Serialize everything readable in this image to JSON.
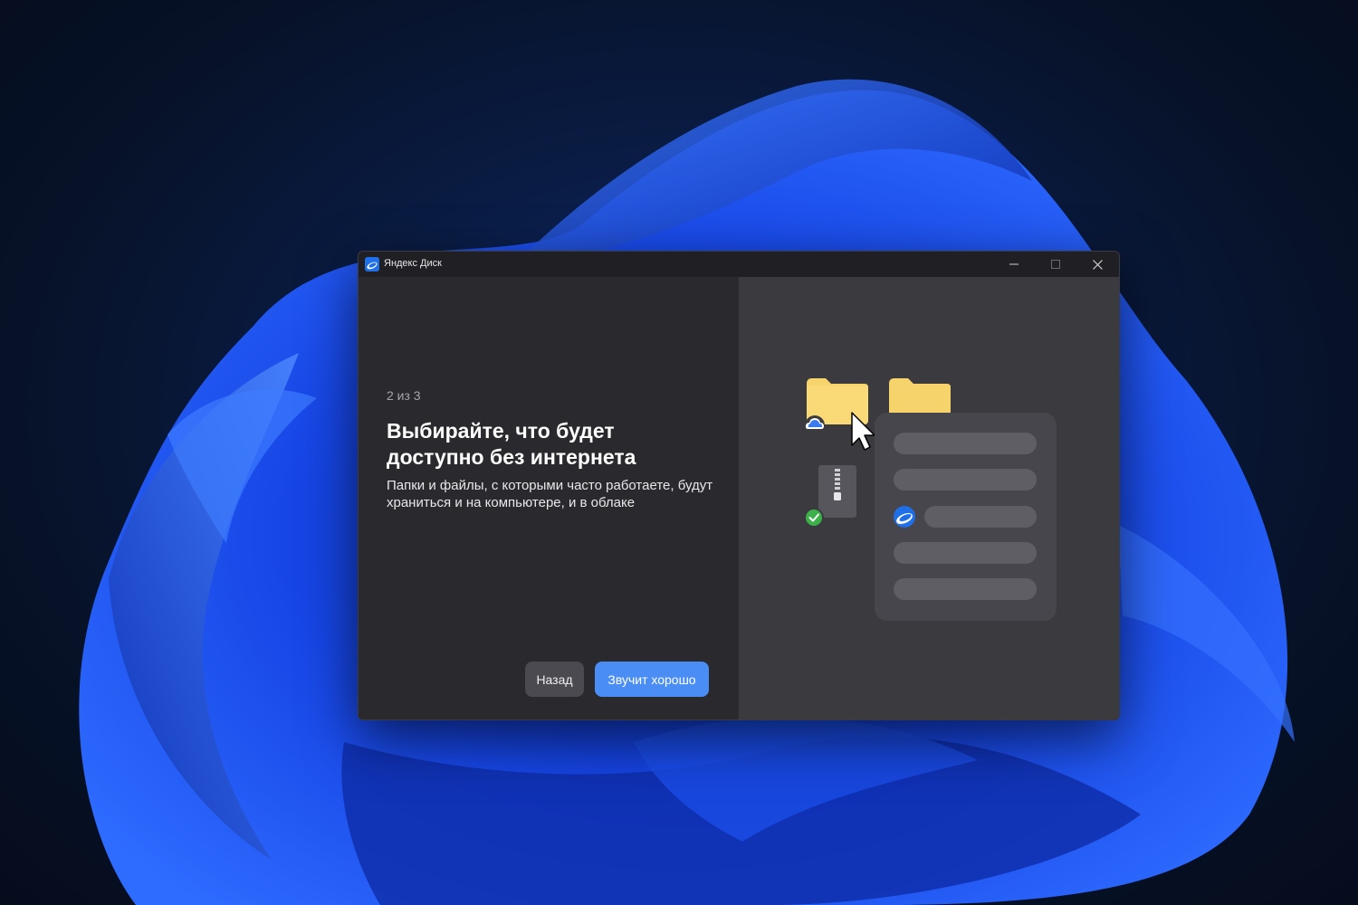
{
  "window": {
    "title": "Яндекс Диск",
    "controls": {
      "minimize": "minimize-icon",
      "maximize": "maximize-icon",
      "close": "close-icon"
    }
  },
  "onboarding": {
    "step": "2 из 3",
    "heading": "Выбирайте, что будет доступно без интернета",
    "description": "Папки и файлы, с которыми часто работаете, будут храниться и на компьютере, и в облаке",
    "buttons": {
      "back": "Назад",
      "ok": "Звучит хорошо"
    }
  },
  "colors": {
    "accent": "#4a8ef5",
    "folder": "#f7d46b",
    "success": "#3cb14a",
    "cloud_badge": "#3a7bf0"
  }
}
